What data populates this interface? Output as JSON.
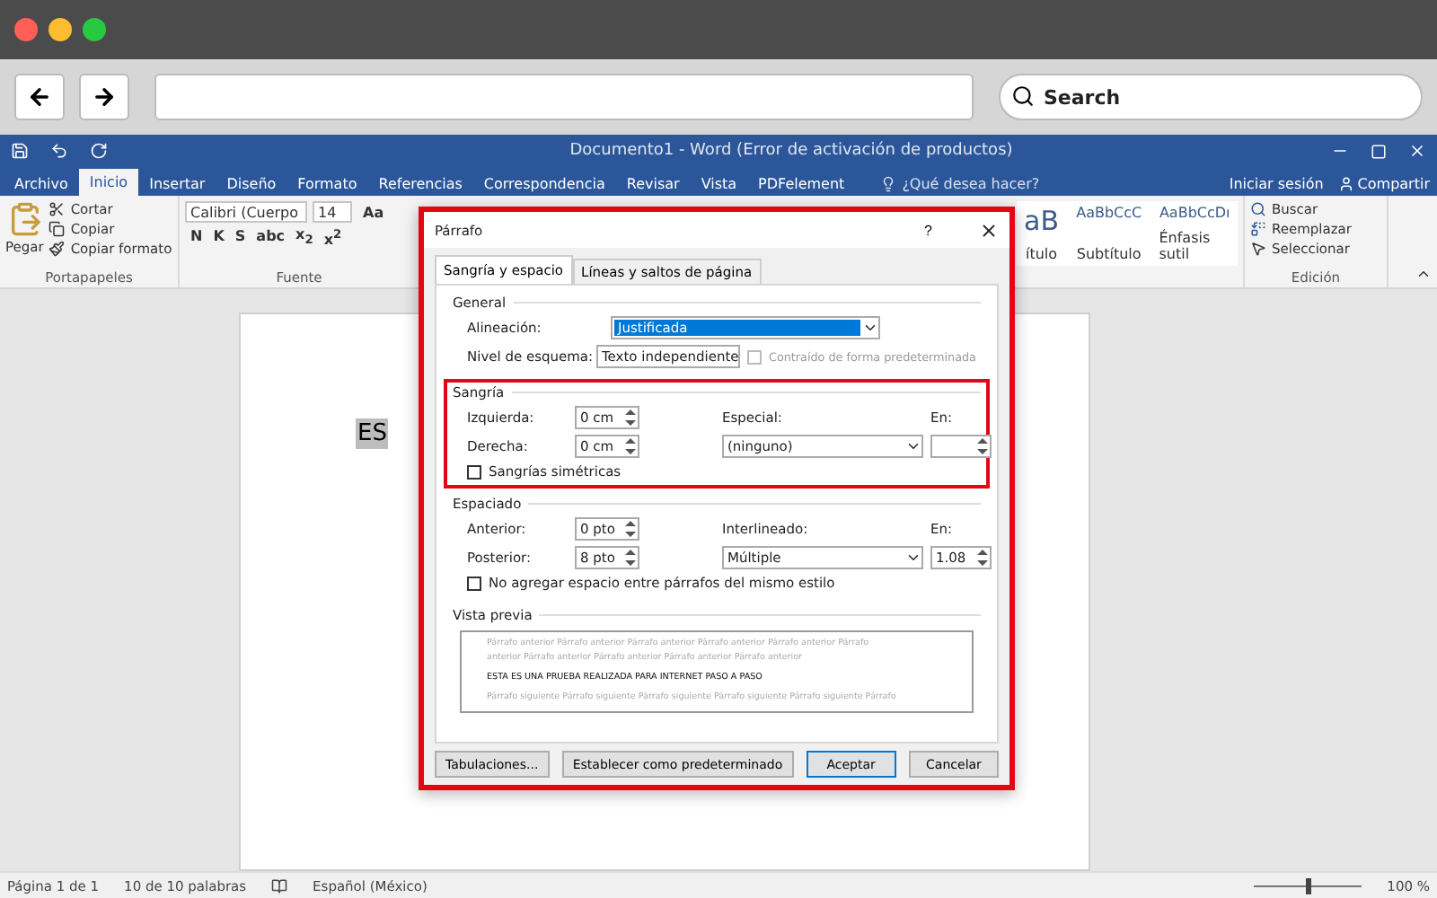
{
  "browser": {
    "search_placeholder": "Search"
  },
  "window": {
    "title": "Documento1 - Word (Error de activación de productos)"
  },
  "menu_tabs": [
    {
      "label": "Archivo",
      "selected": false
    },
    {
      "label": "Inicio",
      "selected": true
    },
    {
      "label": "Insertar",
      "selected": false
    },
    {
      "label": "Diseño",
      "selected": false
    },
    {
      "label": "Formato",
      "selected": false
    },
    {
      "label": "Referencias",
      "selected": false
    },
    {
      "label": "Correspondencia",
      "selected": false
    },
    {
      "label": "Revisar",
      "selected": false
    },
    {
      "label": "Vista",
      "selected": false
    },
    {
      "label": "PDFelement",
      "selected": false
    }
  ],
  "tell_me": "¿Qué desea hacer?",
  "sign_in": "Iniciar sesión",
  "share": "Compartir",
  "ribbon": {
    "clipboard": {
      "paste": "Pegar",
      "items": [
        "Cortar",
        "Copiar",
        "Copiar formato"
      ],
      "label": "Portapapeles"
    },
    "font": {
      "name": "Calibri (Cuerpo",
      "size": "14",
      "case": "Aa",
      "buttons": [
        "N",
        "K",
        "S",
        "abc",
        "x$_{2}$",
        "x$^{2}$"
      ],
      "label": "Fuente"
    },
    "styles": [
      {
        "preview": "aB",
        "name": "ítulo"
      },
      {
        "preview": "AaBbCcC",
        "name": "Subtítulo"
      },
      {
        "preview": "AaBbCcDı",
        "name": "Énfasis sutil"
      }
    ],
    "editing": {
      "items": [
        "Buscar",
        "Reemplazar",
        "Seleccionar"
      ],
      "label": "Edición"
    }
  },
  "document": {
    "text": "ES"
  },
  "dialog": {
    "title": "Párrafo",
    "help": "?",
    "highlighted": true,
    "tabs": [
      {
        "label": "Sangría y espacio",
        "selected": true
      },
      {
        "label": "Líneas y saltos de página",
        "selected": false
      }
    ],
    "general": {
      "title": "General",
      "alignment": {
        "label": "Alineación:",
        "value": "Justificada"
      },
      "outline": {
        "label": "Nivel de esquema:",
        "value": "Texto independiente"
      },
      "collapsed": {
        "label": "Contraído de forma predeterminada",
        "checked": false,
        "disabled": true
      }
    },
    "indent": {
      "title": "Sangría",
      "highlighted": true,
      "left": {
        "label": "Izquierda:",
        "value": "0 cm"
      },
      "right": {
        "label": "Derecha:",
        "value": "0 cm"
      },
      "special": {
        "label": "Especial:",
        "value": "(ninguno)"
      },
      "by": {
        "label": "En:"
      },
      "mirror": {
        "label": "Sangrías simétricas",
        "checked": false
      }
    },
    "spacing": {
      "title": "Espaciado",
      "before": {
        "label": "Anterior:",
        "value": "0 pto"
      },
      "after": {
        "label": "Posterior:",
        "value": "8 pto"
      },
      "line": {
        "label": "Interlineado:",
        "value": "Múltiple"
      },
      "at": {
        "label": "En:",
        "value": "1.08"
      },
      "no_space": {
        "label": "No agregar espacio entre párrafos del mismo estilo",
        "checked": false
      }
    },
    "preview": {
      "title": "Vista previa",
      "lines": [
        {
          "kind": "faint",
          "text": "Párrafo anterior Párrafo anterior Párrafo anterior Párrafo anterior Párrafo anterior Párrafo"
        },
        {
          "kind": "faint",
          "text": "anterior Párrafo anterior Párrafo anterior Párrafo anterior Párrafo anterior"
        },
        {
          "kind": "current",
          "text": "ESTA ES UNA PRUEBA REALIZADA PARA INTERNET PASO A PASO"
        },
        {
          "kind": "faint",
          "text": "Párrafo siguiente Párrafo siguiente Párrafo siguiente Párrafo siguiente Párrafo siguiente Párrafo"
        }
      ]
    },
    "buttons": [
      {
        "label": "Tabulaciones...",
        "default": false
      },
      {
        "label": "Establecer como predeterminado",
        "default": false
      },
      {
        "label": "Aceptar",
        "default": true
      },
      {
        "label": "Cancelar",
        "default": false
      }
    ]
  },
  "status_bar": {
    "page": "Página 1 de 1",
    "words": "10 de 10 palabras",
    "language": "Español (México)",
    "zoom": "100 %",
    "zoom_slider": {
      "level": 0.5
    }
  }
}
